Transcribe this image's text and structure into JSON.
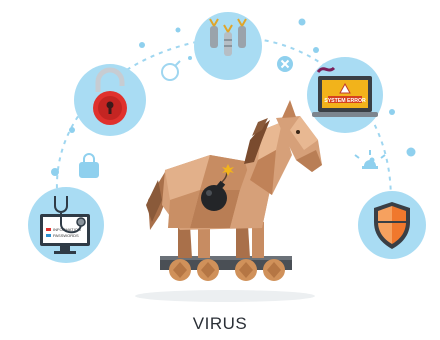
{
  "caption": "VIRUS",
  "laptop": {
    "screen_text": "SYSTEM ERROR"
  },
  "monitor": {
    "lines": [
      "INFORMATION",
      "PASSWORDS"
    ]
  },
  "colors": {
    "circle": "#a9dcf3",
    "dot": "#8fd0ee",
    "dash": "#9fd6f0",
    "horse_light": "#d6a079",
    "horse_mid": "#c78c62",
    "horse_dark": "#a9704a",
    "wood": "#c98b56",
    "lock_red": "#e0312d",
    "shield_orange": "#f0782d",
    "caption": "#2a2f36"
  },
  "icons": [
    "open-padlock-icon",
    "closed-padlock-icon",
    "bug-icon",
    "bomb-icon",
    "close-icon",
    "alarm-light-icon",
    "shield-icon",
    "stethoscope-icon",
    "laptop-error-icon",
    "trojan-horse-icon"
  ]
}
